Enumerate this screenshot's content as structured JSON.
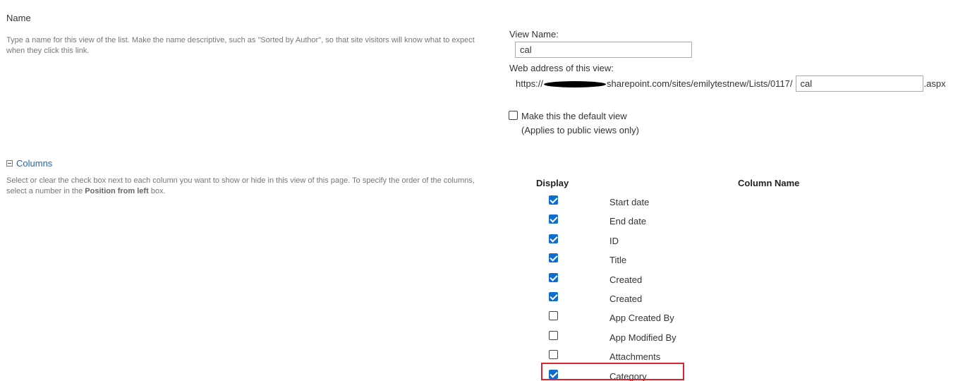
{
  "name_section": {
    "title": "Name",
    "description": "Type a name for this view of the list. Make the name descriptive, such as \"Sorted by Author\", so that site visitors will know what to expect when they click this link.",
    "view_name_label": "View Name:",
    "view_name_value": "cal",
    "web_address_label": "Web address of this view:",
    "url_prefix": "https://",
    "url_middle": "sharepoint.com/sites/emilytestnew/Lists/0117/",
    "url_value": "cal",
    "url_suffix": ".aspx",
    "default_view_label": "Make this the default view",
    "default_view_note": "(Applies to public views only)",
    "default_view_checked": false
  },
  "columns_section": {
    "title": "Columns",
    "description_part1": "Select or clear the check box next to each column you want to show or hide in this view of this page. To specify the order of the columns, select a number in the ",
    "description_bold": "Position from left",
    "description_part2": " box.",
    "header_display": "Display",
    "header_column_name": "Column Name",
    "rows": [
      {
        "name": "Start date",
        "checked": true
      },
      {
        "name": "End date",
        "checked": true
      },
      {
        "name": "ID",
        "checked": true
      },
      {
        "name": "Title",
        "checked": true
      },
      {
        "name": "Created",
        "checked": true
      },
      {
        "name": "Created",
        "checked": true
      },
      {
        "name": "App Created By",
        "checked": false
      },
      {
        "name": "App Modified By",
        "checked": false
      },
      {
        "name": "Attachments",
        "checked": false
      },
      {
        "name": "Category",
        "checked": true
      }
    ],
    "highlighted_row": "Category"
  },
  "colors": {
    "accent": "#0f6cd0",
    "link": "#1f65b5",
    "highlight": "#d9232e"
  },
  "icons": {
    "collapse": "collapse-minus-icon"
  }
}
